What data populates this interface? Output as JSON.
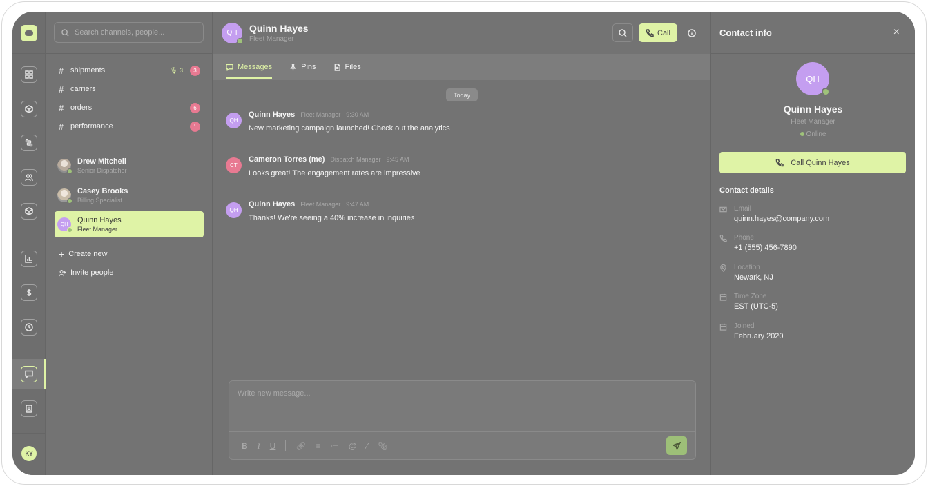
{
  "search": {
    "placeholder": "Search channels, people..."
  },
  "channels": [
    {
      "name": "shipments",
      "mic": "3",
      "badge": "3"
    },
    {
      "name": "carriers",
      "badge": ""
    },
    {
      "name": "orders",
      "badge": "6"
    },
    {
      "name": "performance",
      "badge": "1"
    }
  ],
  "dms": [
    {
      "name": "Drew Mitchell",
      "role": "Senior Dispatcher"
    },
    {
      "name": "Casey Brooks",
      "role": "Billing Specialist"
    },
    {
      "name": "Quinn Hayes",
      "role": "Fleet Manager",
      "initials": "QH"
    }
  ],
  "actions": {
    "create": "Create new",
    "invite": "Invite people"
  },
  "user": {
    "initials": "KY"
  },
  "chat": {
    "name": "Quinn Hayes",
    "role": "Fleet Manager",
    "initials": "QH",
    "call_label": "Call",
    "tabs": [
      "Messages",
      "Pins",
      "Files"
    ],
    "date_divider": "Today",
    "messages": [
      {
        "initials": "QH",
        "author": "Quinn Hayes",
        "role": "Fleet Manager",
        "time": "9:30 AM",
        "text": "New marketing campaign launched! Check out the analytics",
        "color": "#c49ef0"
      },
      {
        "initials": "CT",
        "author": "Cameron Torres (me)",
        "role": "Dispatch Manager",
        "time": "9:45 AM",
        "text": "Looks great! The engagement rates are impressive",
        "color": "#e87a92"
      },
      {
        "initials": "QH",
        "author": "Quinn Hayes",
        "role": "Fleet Manager",
        "time": "9:47 AM",
        "text": "Thanks! We're seeing a 40% increase in inquiries",
        "color": "#c49ef0"
      }
    ],
    "composer_placeholder": "Write new message..."
  },
  "contact": {
    "title": "Contact info",
    "initials": "QH",
    "name": "Quinn Hayes",
    "role": "Fleet Manager",
    "status": "Online",
    "call_button": "Call Quinn Hayes",
    "details_heading": "Contact details",
    "details": [
      {
        "label": "Email",
        "value": "quinn.hayes@company.com",
        "icon": "mail-icon"
      },
      {
        "label": "Phone",
        "value": "+1 (555) 456-7890",
        "icon": "phone-icon"
      },
      {
        "label": "Location",
        "value": "Newark, NJ",
        "icon": "location-pin-icon"
      },
      {
        "label": "Time Zone",
        "value": "EST (UTC-5)",
        "icon": "calendar-icon"
      },
      {
        "label": "Joined",
        "value": "February 2020",
        "icon": "calendar-icon"
      }
    ]
  },
  "colors": {
    "accent": "#dff3a6",
    "badge": "#e87a92",
    "avatar_purple": "#c49ef0",
    "online": "#9fc27a"
  }
}
